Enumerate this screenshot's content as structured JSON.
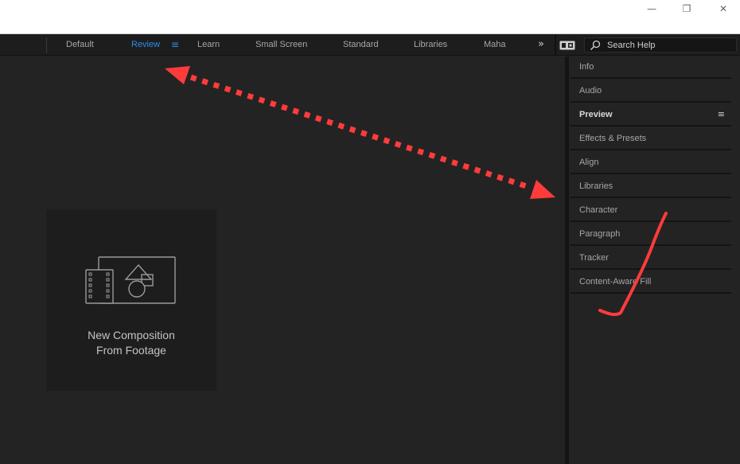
{
  "window": {
    "minimize_glyph": "—",
    "maximize_glyph": "❐",
    "close_glyph": "✕"
  },
  "workspaces": {
    "tabs": [
      {
        "label": "Default",
        "active": false
      },
      {
        "label": "Review",
        "active": true
      },
      {
        "label": "Learn",
        "active": false
      },
      {
        "label": "Small Screen",
        "active": false
      },
      {
        "label": "Standard",
        "active": false
      },
      {
        "label": "Libraries",
        "active": false
      },
      {
        "label": "Maha",
        "active": false
      }
    ],
    "menu_glyph": "≡",
    "overflow_glyph": "»",
    "search_placeholder": "Search Help"
  },
  "composition": {
    "line1": "New Composition",
    "line2": "From Footage"
  },
  "panels": {
    "items": [
      {
        "label": "Info",
        "active": false
      },
      {
        "label": "Audio",
        "active": false
      },
      {
        "label": "Preview",
        "active": true
      },
      {
        "label": "Effects & Presets",
        "active": false
      },
      {
        "label": "Align",
        "active": false
      },
      {
        "label": "Libraries",
        "active": false
      },
      {
        "label": "Character",
        "active": false
      },
      {
        "label": "Paragraph",
        "active": false
      },
      {
        "label": "Tracker",
        "active": false
      },
      {
        "label": "Content-Aware Fill",
        "active": false
      }
    ],
    "menu_glyph": "≡"
  },
  "colors": {
    "accent_blue": "#2d8ceb",
    "annotation_red": "#ff3b3b",
    "background": "#232323"
  }
}
